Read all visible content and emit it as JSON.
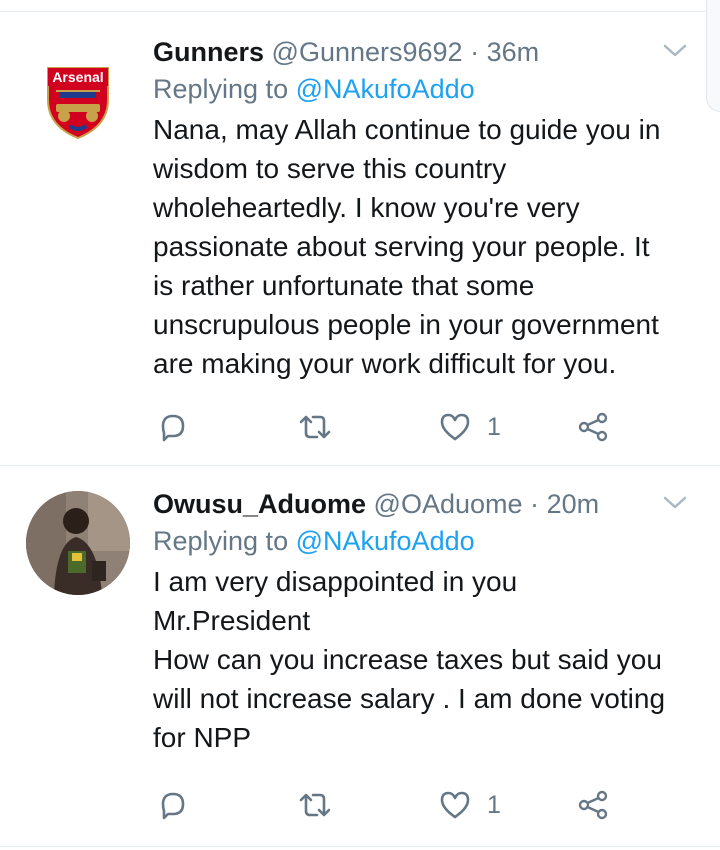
{
  "colors": {
    "text": "#14171a",
    "muted": "#657786",
    "link": "#1da1f2",
    "divider": "#e6ecf0"
  },
  "tweets": [
    {
      "name": "Gunners",
      "handle": "@Gunners9692",
      "separator": "·",
      "time": "36m",
      "replying_prefix": "Replying to",
      "replying_to": "@NAkufoAddo",
      "text": "Nana, may Allah continue to guide you in\nwisdom to serve this country\nwholeheartedly. I know you're very\npassionate about serving your people. It\nis rather unfortunate that some\nunscrupulous people in your government\nare making your work difficult for you.",
      "avatar_logo_text": "Arsenal",
      "avatar_icon": "arsenal-crest-icon",
      "likes": "1"
    },
    {
      "name": "Owusu_Aduome",
      "handle": "@OAduome",
      "separator": "·",
      "time": "20m",
      "replying_prefix": "Replying to",
      "replying_to": "@NAkufoAddo",
      "text": "I am very disappointed in you\nMr.President\nHow can you increase taxes but said you\nwill not increase salary . I am done voting\nfor NPP",
      "avatar_icon": "user-photo-icon",
      "likes": "1"
    }
  ],
  "action_icons": [
    "reply-icon",
    "retweet-icon",
    "like-icon",
    "share-icon"
  ]
}
